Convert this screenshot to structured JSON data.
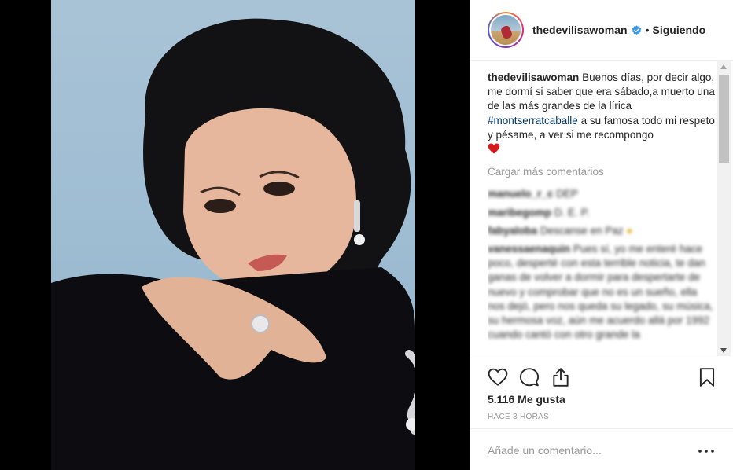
{
  "header": {
    "username": "thedevilisawoman",
    "separator": "•",
    "follow_status": "Siguiendo"
  },
  "caption": {
    "username": "thedevilisawoman",
    "text_before": "Buenos días, por decir algo, me dormí si saber que era sábado,a muerto una de las más grandes de la lírica",
    "hashtag": "#montserratcaballe",
    "text_after": "a su famosa todo mi respeto y pésame, a ver si me recompongo"
  },
  "load_more": "Cargar más comentarios",
  "comments": [
    {
      "user": "manuelo_r_c",
      "text": "DEP"
    },
    {
      "user": "maribegomp",
      "text": "D. E. P."
    },
    {
      "user": "fabyaloba",
      "text": "Descanse en Paz"
    },
    {
      "user": "vanessaenaquin",
      "text": "Pues sí, yo me enteré hace poco, desperté con esta terrible noticia, te dan ganas de volver a dormir para despertarte de nuevo y comprobar que no es un sueño, ella nos dejó, pero nos queda su legado, su música, su hermosa voz, aún me acuerdo allá por 1992 cuando cantó con otro grande la"
    }
  ],
  "likes": "5.116 Me gusta",
  "timestamp": "Hace 3 horas",
  "comment_input": {
    "placeholder": "Añade un comentario..."
  },
  "colors": {
    "hashtag": "#003569",
    "verified": "#3897f0",
    "heart": "#d41a1a"
  },
  "icons": [
    "verified-badge-icon",
    "heart-icon",
    "comment-icon",
    "share-icon",
    "bookmark-icon",
    "more-options-icon",
    "red-heart-emoji-icon"
  ]
}
